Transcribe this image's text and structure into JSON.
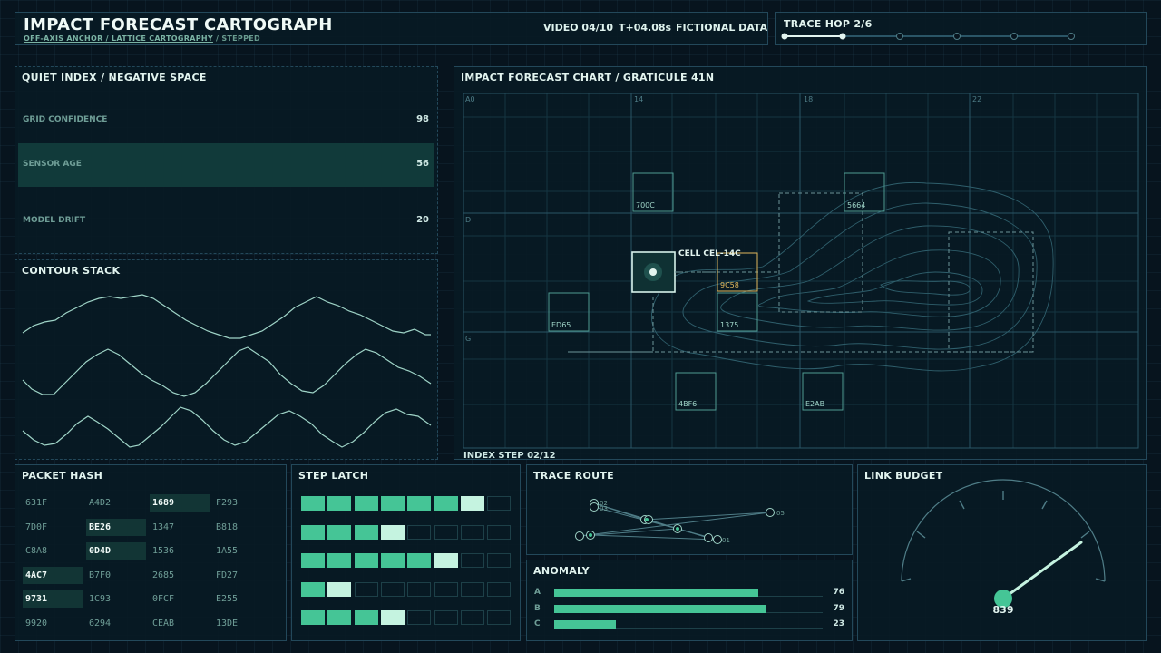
{
  "header": {
    "title": "IMPACT FORECAST CARTOGRAPH",
    "subtitle_a": "OFF-AXIS ANCHOR / LATTICE CARTOGRAPHY",
    "subtitle_b": " / STEPPED",
    "video": "VIDEO 04/10",
    "time": "T+04.08s",
    "data_note": "FICTIONAL DATA"
  },
  "trace_hop": {
    "title": "TRACE HOP 2/6",
    "total": 6,
    "current": 2
  },
  "quiet_index": {
    "title": "QUIET INDEX / NEGATIVE SPACE",
    "rows": [
      {
        "label": "GRID CONFIDENCE",
        "value": "98",
        "selected": false
      },
      {
        "label": "SENSOR AGE",
        "value": "56",
        "selected": true
      },
      {
        "label": "MODEL DRIFT",
        "value": "20",
        "selected": false
      }
    ]
  },
  "contour_stack": {
    "title": "CONTOUR STACK"
  },
  "chart": {
    "title": "IMPACT FORECAST CHART / GRATICULE 41N",
    "col_labels": [
      "A0",
      "14",
      "18",
      "22"
    ],
    "row_labels": [
      "D",
      "G"
    ],
    "footer": "INDEX STEP 02/12",
    "focus_label": "CELL CEL-14C",
    "cells": [
      {
        "id": "700C",
        "state": "normal"
      },
      {
        "id": "5664",
        "state": "normal"
      },
      {
        "id": "9C58",
        "state": "warn"
      },
      {
        "id": "ED65",
        "state": "normal"
      },
      {
        "id": "1375",
        "state": "normal"
      },
      {
        "id": "4BF6",
        "state": "normal"
      },
      {
        "id": "E2AB",
        "state": "normal"
      }
    ]
  },
  "packet_hash": {
    "title": "PACKET HASH",
    "rows": [
      [
        "631F",
        "A4D2",
        "1689",
        "F293"
      ],
      [
        "7D0F",
        "BE26",
        "1347",
        "B818"
      ],
      [
        "C8A8",
        "0D4D",
        "1536",
        "1A55"
      ],
      [
        "4AC7",
        "B7F0",
        "2685",
        "FD27"
      ],
      [
        "9731",
        "1C93",
        "0FCF",
        "E255"
      ],
      [
        "9920",
        "6294",
        "CEAB",
        "13DE"
      ]
    ],
    "highlighted": [
      "1689",
      "BE26",
      "0D4D",
      "4AC7",
      "9731"
    ]
  },
  "step_latch": {
    "title": "STEP LATCH",
    "segments": 8,
    "levels": [
      7,
      4,
      6,
      2,
      4
    ]
  },
  "trace_route": {
    "title": "TRACE ROUTE",
    "node_labels": [
      "02",
      "03",
      "05",
      "01"
    ]
  },
  "anomaly": {
    "title": "ANOMALY",
    "bars": [
      {
        "label": "A",
        "value": 76
      },
      {
        "label": "B",
        "value": 79
      },
      {
        "label": "C",
        "value": 23
      }
    ]
  },
  "link_budget": {
    "title": "LINK BUDGET",
    "value": "839"
  },
  "colors": {
    "accent": "#45c596",
    "accent_light": "#c5f3e0",
    "warn": "#e0b85c",
    "border": "#23485a",
    "grid": "#2a5566"
  },
  "icons": {
    "focus": "target-reticle-icon",
    "hop": "hop-node-icon"
  }
}
